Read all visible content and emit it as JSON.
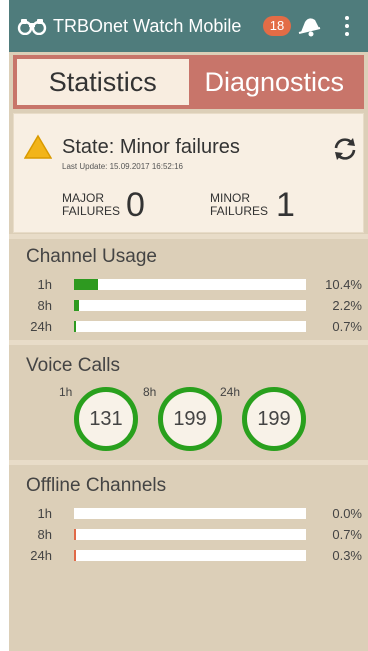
{
  "appbar": {
    "title": "TRBOnet Watch Mobile",
    "notification_count": "18",
    "icons": [
      "binoculars-icon",
      "bell-icon",
      "more-vert-icon"
    ]
  },
  "tabs": [
    {
      "label": "Statistics",
      "active": true
    },
    {
      "label": "Diagnostics",
      "active": false
    }
  ],
  "state": {
    "title": "State: Minor failures",
    "last_update": "Last Update: 15.09.2017 16:52:16",
    "major_label_1": "MAJOR",
    "major_label_2": "FAILURES",
    "major_count": "0",
    "minor_label_1": "MINOR",
    "minor_label_2": "FAILURES",
    "minor_count": "1",
    "icons": [
      "warning-icon",
      "refresh-icon"
    ]
  },
  "channel_usage": {
    "title": "Channel Usage",
    "rows": [
      {
        "label": "1h",
        "value": "10.4%",
        "fraction": 0.104
      },
      {
        "label": "8h",
        "value": "2.2%",
        "fraction": 0.022
      },
      {
        "label": "24h",
        "value": "0.7%",
        "fraction": 0.007
      }
    ]
  },
  "voice_calls": {
    "title": "Voice Calls",
    "items": [
      {
        "label": "1h",
        "value": "131"
      },
      {
        "label": "8h",
        "value": "199"
      },
      {
        "label": "24h",
        "value": "199"
      }
    ]
  },
  "offline_channels": {
    "title": "Offline Channels",
    "rows": [
      {
        "label": "1h",
        "value": "0.0%",
        "fraction": 0.0
      },
      {
        "label": "8h",
        "value": "0.7%",
        "fraction": 0.007
      },
      {
        "label": "24h",
        "value": "0.3%",
        "fraction": 0.003
      }
    ]
  },
  "colors": {
    "appbar": "#4f7c7c",
    "tab_strip": "#c8756a",
    "background": "#dccfb8",
    "usage_bar": "#2e9a20",
    "offline_bar": "#e06a48",
    "ring": "#29a01d",
    "badge": "#e36c46",
    "warning": "#f2b419"
  }
}
